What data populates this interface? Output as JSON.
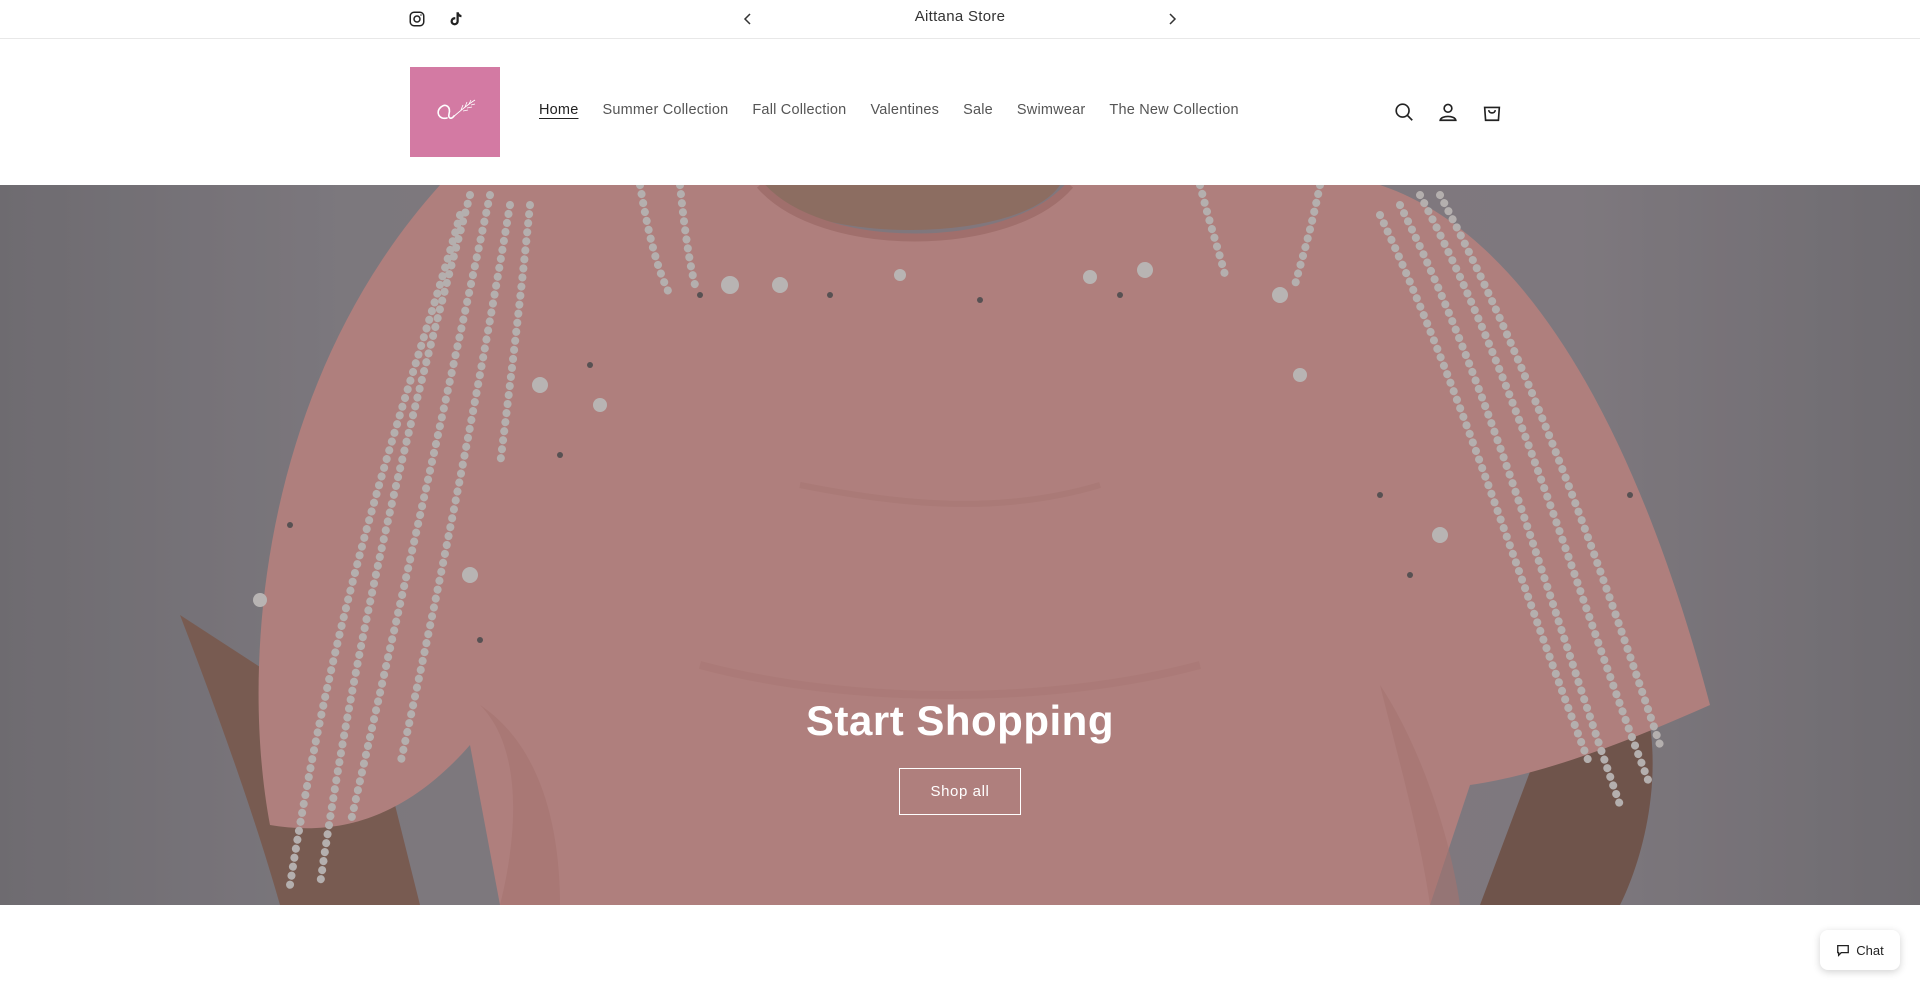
{
  "announcement": {
    "text": "Aittana Store",
    "social": [
      "instagram-icon",
      "tiktok-icon"
    ],
    "prev_icon": "chevron-left-icon",
    "next_icon": "chevron-right-icon"
  },
  "header": {
    "logo_icon": "aittana-logo",
    "logo_color": "#d37aa3",
    "nav": [
      {
        "label": "Home",
        "active": true
      },
      {
        "label": "Summer Collection",
        "active": false
      },
      {
        "label": "Fall Collection",
        "active": false
      },
      {
        "label": "Valentines",
        "active": false
      },
      {
        "label": "Sale",
        "active": false
      },
      {
        "label": "Swimwear",
        "active": false
      },
      {
        "label": "The New Collection",
        "active": false
      }
    ],
    "icons": [
      "search-icon",
      "account-icon",
      "cart-icon"
    ]
  },
  "hero": {
    "title": "Start Shopping",
    "button_label": "Shop all"
  },
  "chat": {
    "label": "Chat",
    "icon": "chat-bubble-icon"
  }
}
